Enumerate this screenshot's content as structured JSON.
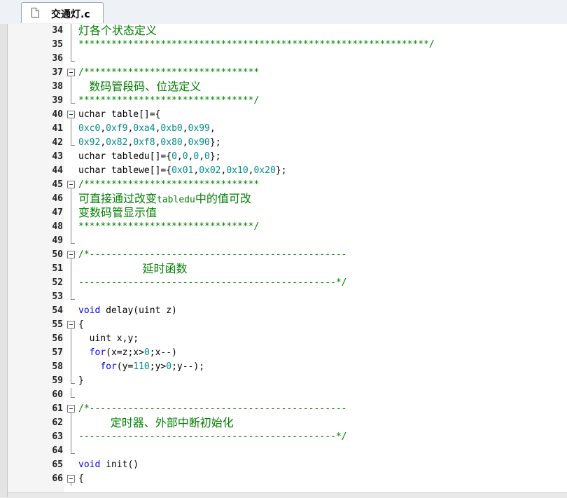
{
  "tab": {
    "filename": "交通灯.c",
    "icon": "file-icon"
  },
  "colors": {
    "comment": "#008000",
    "keyword": "#0000ff",
    "number": "#008b8b",
    "text": "#000000"
  },
  "lines": [
    {
      "n": "34",
      "fold": "bar",
      "parts": [
        [
          "cmz",
          "灯各个状态定义"
        ]
      ]
    },
    {
      "n": "35",
      "fold": "bar",
      "parts": [
        [
          "cm",
          "****************************************************************/"
        ]
      ]
    },
    {
      "n": "36",
      "fold": "end",
      "parts": []
    },
    {
      "n": "37",
      "fold": "box",
      "parts": [
        [
          "cm",
          "/********************************"
        ]
      ]
    },
    {
      "n": "38",
      "fold": "bar",
      "parts": [
        [
          "cmz",
          "   数码管段码、位选定义"
        ]
      ]
    },
    {
      "n": "39",
      "fold": "end",
      "parts": [
        [
          "cm",
          "********************************/"
        ]
      ]
    },
    {
      "n": "40",
      "fold": "box",
      "parts": [
        [
          "t",
          "uchar table[]={"
        ]
      ]
    },
    {
      "n": "41",
      "fold": "bar",
      "parts": [
        [
          "num",
          "0xc0"
        ],
        [
          "t",
          ","
        ],
        [
          "num",
          "0xf9"
        ],
        [
          "t",
          ","
        ],
        [
          "num",
          "0xa4"
        ],
        [
          "t",
          ","
        ],
        [
          "num",
          "0xb0"
        ],
        [
          "t",
          ","
        ],
        [
          "num",
          "0x99"
        ],
        [
          "t",
          ","
        ]
      ]
    },
    {
      "n": "42",
      "fold": "end",
      "parts": [
        [
          "num",
          "0x92"
        ],
        [
          "t",
          ","
        ],
        [
          "num",
          "0x82"
        ],
        [
          "t",
          ","
        ],
        [
          "num",
          "0xf8"
        ],
        [
          "t",
          ","
        ],
        [
          "num",
          "0x80"
        ],
        [
          "t",
          ","
        ],
        [
          "num",
          "0x90"
        ],
        [
          "t",
          "};"
        ]
      ]
    },
    {
      "n": "43",
      "fold": "",
      "parts": [
        [
          "t",
          "uchar tabledu[]={"
        ],
        [
          "num",
          "0"
        ],
        [
          "t",
          ","
        ],
        [
          "num",
          "0"
        ],
        [
          "t",
          ","
        ],
        [
          "num",
          "0"
        ],
        [
          "t",
          ","
        ],
        [
          "num",
          "0"
        ],
        [
          "t",
          "};"
        ]
      ]
    },
    {
      "n": "44",
      "fold": "",
      "parts": [
        [
          "t",
          "uchar tablewe[]={"
        ],
        [
          "num",
          "0x01"
        ],
        [
          "t",
          ","
        ],
        [
          "num",
          "0x02"
        ],
        [
          "t",
          ","
        ],
        [
          "num",
          "0x10"
        ],
        [
          "t",
          ","
        ],
        [
          "num",
          "0x20"
        ],
        [
          "t",
          "};"
        ]
      ]
    },
    {
      "n": "45",
      "fold": "box",
      "parts": [
        [
          "cm",
          "/********************************"
        ]
      ]
    },
    {
      "n": "46",
      "fold": "bar",
      "parts": [
        [
          "cmz",
          "可直接通过改变"
        ],
        [
          "cm",
          "tabledu"
        ],
        [
          "cmz",
          "中的值可改"
        ]
      ]
    },
    {
      "n": "47",
      "fold": "bar",
      "parts": [
        [
          "cmz",
          "变数码管显示值"
        ]
      ]
    },
    {
      "n": "48",
      "fold": "bar",
      "parts": [
        [
          "cm",
          "********************************/"
        ]
      ]
    },
    {
      "n": "49",
      "fold": "end",
      "parts": []
    },
    {
      "n": "50",
      "fold": "box",
      "parts": [
        [
          "cm",
          "/*-----------------------------------------------"
        ]
      ]
    },
    {
      "n": "51",
      "fold": "bar",
      "parts": [
        [
          "cmz",
          "                  延时函数"
        ]
      ]
    },
    {
      "n": "52",
      "fold": "bar",
      "parts": [
        [
          "cm",
          "-----------------------------------------------*/"
        ]
      ]
    },
    {
      "n": "53",
      "fold": "end",
      "parts": []
    },
    {
      "n": "54",
      "fold": "",
      "parts": [
        [
          "kw",
          "void"
        ],
        [
          "t",
          " delay(uint z)"
        ]
      ]
    },
    {
      "n": "55",
      "fold": "box",
      "parts": [
        [
          "t",
          "{"
        ]
      ]
    },
    {
      "n": "56",
      "fold": "bar",
      "parts": [
        [
          "t",
          "  uint x,y;"
        ]
      ]
    },
    {
      "n": "57",
      "fold": "bar",
      "parts": [
        [
          "t",
          "  "
        ],
        [
          "kw",
          "for"
        ],
        [
          "t",
          "(x=z;x>"
        ],
        [
          "num",
          "0"
        ],
        [
          "t",
          ";x--)"
        ]
      ]
    },
    {
      "n": "58",
      "fold": "bar",
      "parts": [
        [
          "t",
          "    "
        ],
        [
          "kw",
          "for"
        ],
        [
          "t",
          "(y="
        ],
        [
          "num",
          "110"
        ],
        [
          "t",
          ";y>"
        ],
        [
          "num",
          "0"
        ],
        [
          "t",
          ";y--);"
        ]
      ]
    },
    {
      "n": "59",
      "fold": "end",
      "parts": [
        [
          "t",
          "}"
        ]
      ]
    },
    {
      "n": "60",
      "fold": "end",
      "parts": []
    },
    {
      "n": "61",
      "fold": "box",
      "parts": [
        [
          "cm",
          "/*-----------------------------------------------"
        ]
      ]
    },
    {
      "n": "62",
      "fold": "bar",
      "parts": [
        [
          "cmz",
          "         定时器、外部中断初始化"
        ]
      ]
    },
    {
      "n": "63",
      "fold": "bar",
      "parts": [
        [
          "cm",
          "-----------------------------------------------*/"
        ]
      ]
    },
    {
      "n": "64",
      "fold": "end",
      "parts": []
    },
    {
      "n": "65",
      "fold": "",
      "parts": [
        [
          "kw",
          "void"
        ],
        [
          "t",
          " init()"
        ]
      ]
    },
    {
      "n": "66",
      "fold": "box",
      "parts": [
        [
          "t",
          "{"
        ]
      ]
    }
  ]
}
